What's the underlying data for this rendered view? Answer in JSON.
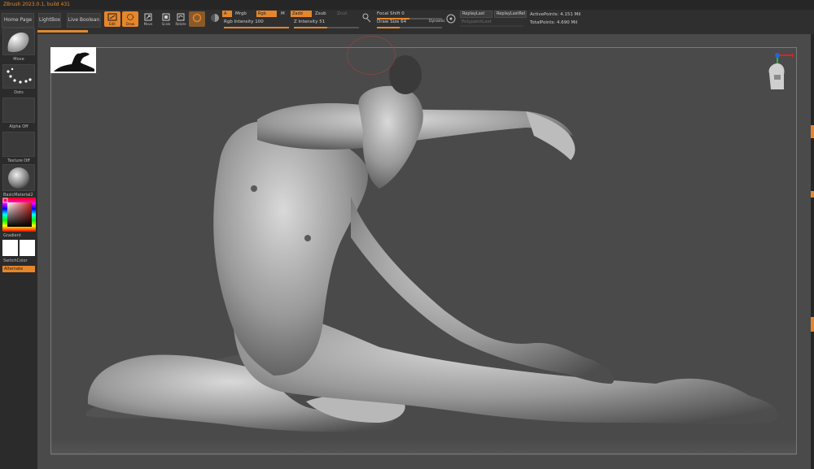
{
  "app": {
    "title": "ZBrush 2023.0.1, build 431"
  },
  "colors": {
    "accent": "#e6862b",
    "viewport": "#4a4a4a",
    "panel": "#2f2f2f"
  },
  "tabs": [
    {
      "label": "Home Page"
    },
    {
      "label": "LightBox"
    },
    {
      "label": "Live Boolean"
    }
  ],
  "tools": [
    {
      "label": "Edit",
      "icon": "edit-icon",
      "active": true
    },
    {
      "label": "Draw",
      "icon": "draw-icon",
      "active": true
    },
    {
      "label": "Move",
      "icon": "move-icon",
      "active": false
    },
    {
      "label": "Scale",
      "icon": "scale-icon",
      "active": false
    },
    {
      "label": "Rotate",
      "icon": "rotate-icon",
      "active": false
    }
  ],
  "brush": {
    "a_chip": "A",
    "mrgb": "Mrgb",
    "rgb_chip": "Rgb",
    "m": "M",
    "rgb_intensity": "Rgb Intensity 100",
    "zadd_chip": "Zadd",
    "zsub": "Zsub",
    "zcut": "Zcut",
    "z_intensity": "Z Intensity 51",
    "focal_shift": "Focal Shift 0",
    "draw_size": "Draw Size 64",
    "dynamic": "Dynamic",
    "rgb_intensity_level": 1.0,
    "z_intensity_level": 0.51,
    "focal_shift_level": 0.5,
    "draw_size_level": 0.35
  },
  "replay": {
    "replay_last": "ReplayLast",
    "replay_last_rel": "ReplayLastRel",
    "polypaint": "PolypaintLast"
  },
  "stats": {
    "active_points": "ActivePoints: 4.151 Mil",
    "total_points": "TotalPoints: 4.690 Mil"
  },
  "left_shelf": {
    "brush_label": "Move",
    "stroke_label": "Dots",
    "alpha_label": "Alpha Off",
    "texture_label": "Texture Off",
    "material_label": "BasicMaterial2",
    "gradient_label": "Gradient",
    "switch_color_label": "SwitchColor",
    "alternate_label": "Alternate"
  }
}
